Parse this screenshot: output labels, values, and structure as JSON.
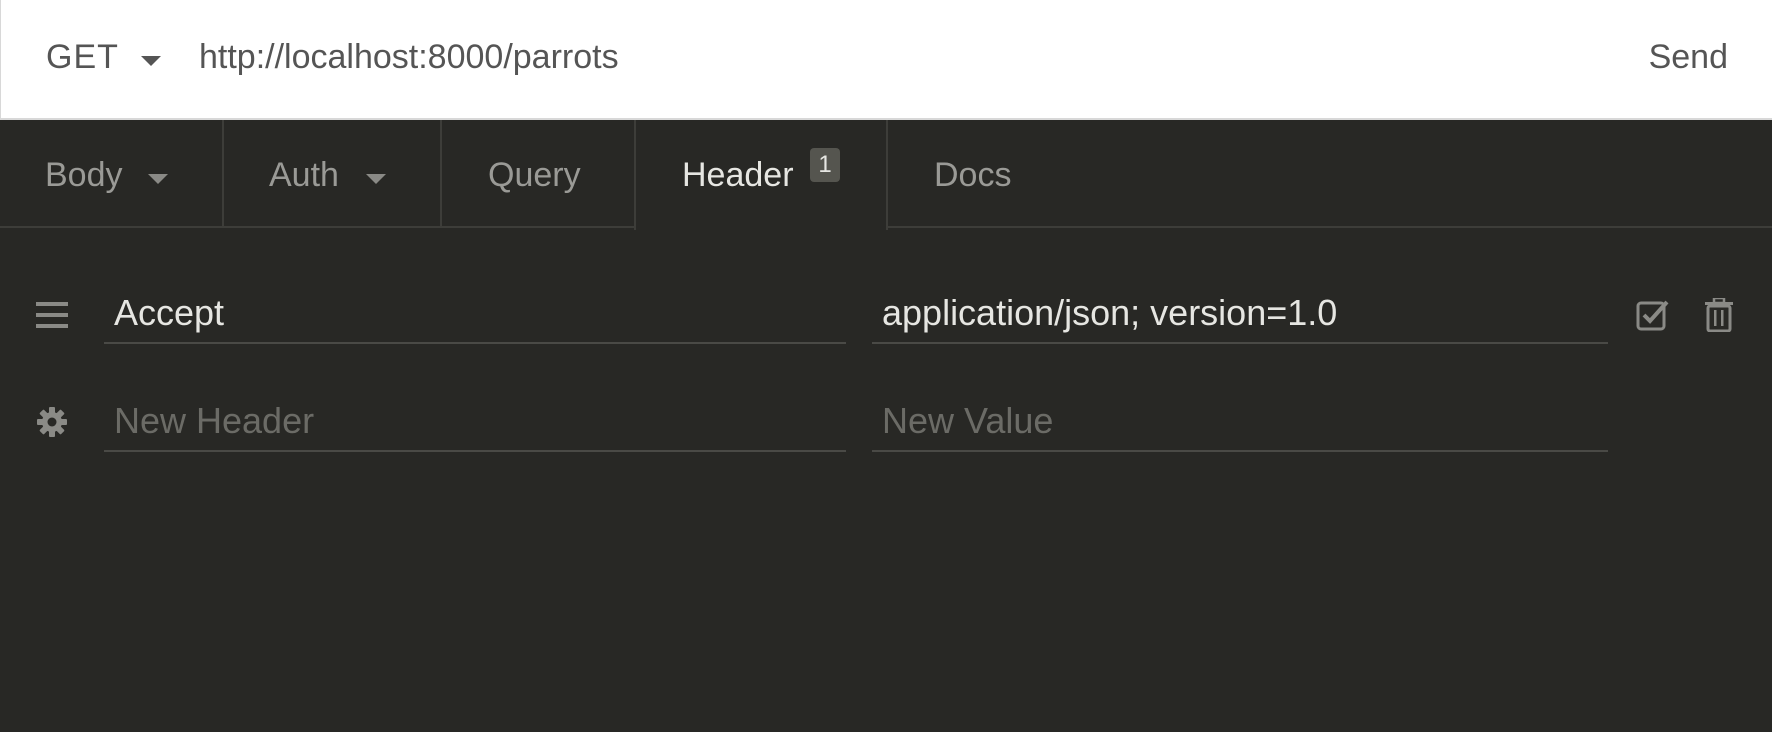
{
  "request": {
    "method": "GET",
    "url": "http://localhost:8000/parrots",
    "send_label": "Send"
  },
  "tabs": [
    {
      "label": "Body",
      "has_dropdown": true
    },
    {
      "label": "Auth",
      "has_dropdown": true
    },
    {
      "label": "Query",
      "has_dropdown": false
    },
    {
      "label": "Header",
      "badge": "1",
      "active": true
    },
    {
      "label": "Docs",
      "has_dropdown": false
    }
  ],
  "headers": [
    {
      "name": "Accept",
      "value": "application/json; version=1.0",
      "enabled": true
    }
  ],
  "new_header": {
    "name_placeholder": "New Header",
    "value_placeholder": "New Value"
  },
  "icons": {
    "drag_handle": "hamburger-icon",
    "settings": "gear-icon",
    "enabled_toggle": "checkbox-checked-icon",
    "delete": "trash-icon"
  },
  "colors": {
    "panel_bg": "#282825",
    "urlbar_bg": "#ffffff",
    "active_text": "#e6e6e2",
    "muted_text": "#9a9a96"
  }
}
